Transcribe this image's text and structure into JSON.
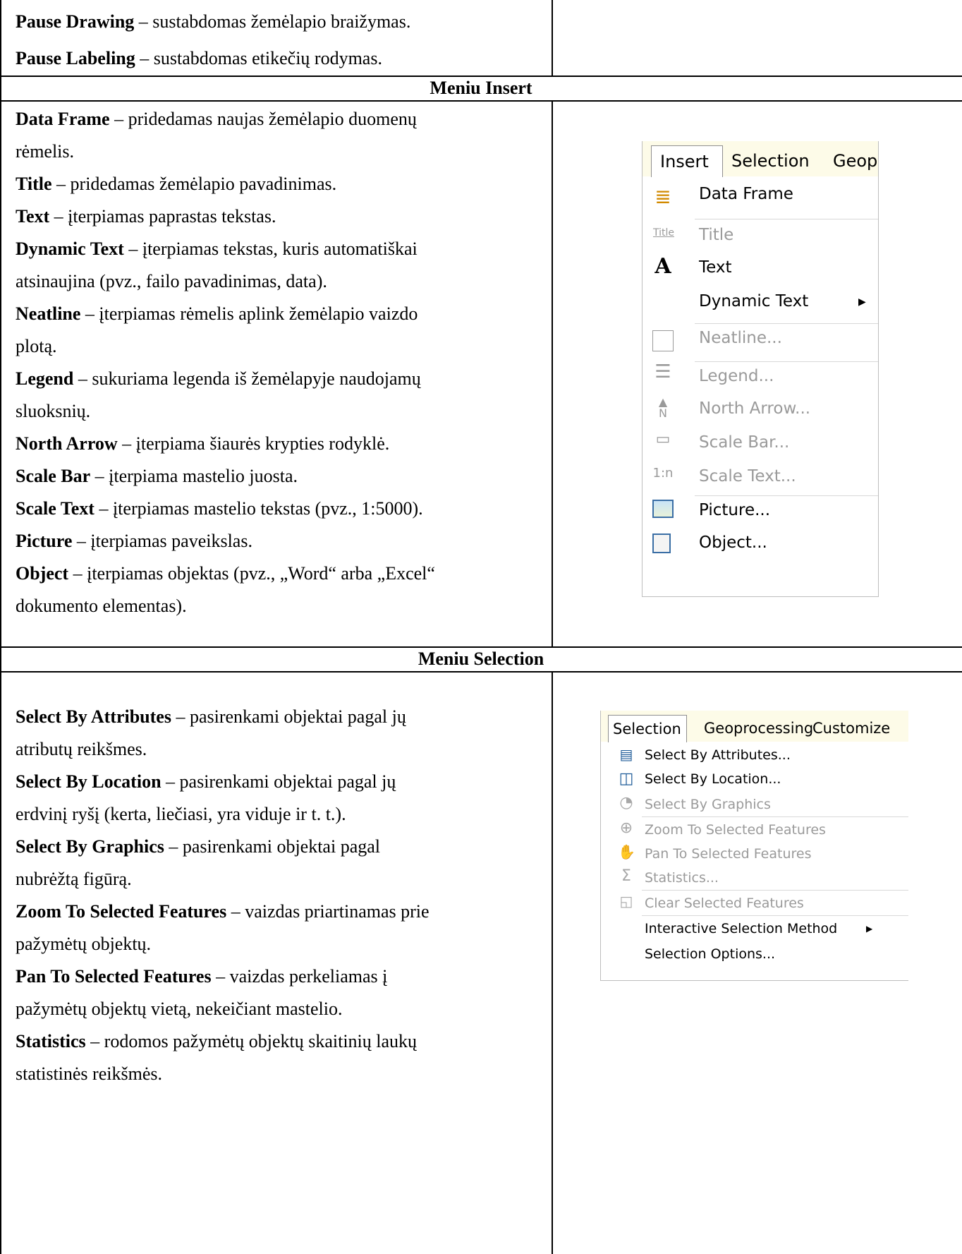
{
  "top_rows": [
    {
      "term": "Pause Drawing",
      "text": " – sustabdomas žemėlapio braižymas."
    },
    {
      "term": "Pause Labeling",
      "text": " – sustabdomas etikečių rodymas."
    }
  ],
  "insert_section": {
    "title": "Meniu Insert",
    "lines": [
      {
        "term": "Data Frame",
        "text": " – pridedamas naujas žemėlapio duomenų"
      },
      {
        "term": "",
        "text": "rėmelis."
      },
      {
        "term": "Title",
        "text": " – pridedamas žemėlapio pavadinimas."
      },
      {
        "term": "Text",
        "text": " – įterpiamas paprastas tekstas."
      },
      {
        "term": "Dynamic Text",
        "text": " – įterpiamas tekstas, kuris automatiškai"
      },
      {
        "term": "",
        "text": "atsinaujina (pvz., failo pavadinimas, data)."
      },
      {
        "term": "Neatline",
        "text": " – įterpiamas rėmelis aplink žemėlapio vaizdo"
      },
      {
        "term": "",
        "text": "plotą."
      },
      {
        "term": "Legend",
        "text": " – sukuriama legenda iš žemėlapyje naudojamų"
      },
      {
        "term": "",
        "text": "sluoksnių."
      },
      {
        "term": "North Arrow",
        "text": " – įterpiama šiaurės krypties rodyklė."
      },
      {
        "term": "Scale Bar",
        "text": " – įterpiama mastelio juosta."
      },
      {
        "term": "Scale Text",
        "text": " – įterpiamas mastelio tekstas (pvz., 1:5000)."
      },
      {
        "term": "Picture",
        "text": " – įterpiamas paveikslas."
      },
      {
        "term": "Object",
        "text": " – įterpiamas objektas (pvz., „Word“ arba „Excel“"
      },
      {
        "term": "",
        "text": "dokumento elementas)."
      }
    ],
    "menu": {
      "tabs": [
        "Insert",
        "Selection",
        "Geop"
      ],
      "items": [
        {
          "label": "Data Frame",
          "icon": "layers-icon",
          "glyph": "≣",
          "disabled": false
        },
        {
          "label": "Title",
          "icon": "title-icon",
          "glyph": "Title",
          "disabled": true
        },
        {
          "label": "Text",
          "icon": "text-a-icon",
          "glyph": "A",
          "disabled": false
        },
        {
          "label": "Dynamic Text",
          "icon": "",
          "glyph": "",
          "disabled": false,
          "submenu": true
        },
        {
          "label": "Neatline...",
          "icon": "neatline-icon",
          "glyph": "□",
          "disabled": true
        },
        {
          "label": "Legend...",
          "icon": "legend-icon",
          "glyph": "☰",
          "disabled": true
        },
        {
          "label": "North Arrow...",
          "icon": "north-arrow-icon",
          "glyph": "N",
          "disabled": true
        },
        {
          "label": "Scale Bar...",
          "icon": "scale-bar-icon",
          "glyph": "▭",
          "disabled": true
        },
        {
          "label": "Scale Text...",
          "icon": "scale-text-icon",
          "glyph": "1:n",
          "disabled": true
        },
        {
          "label": "Picture...",
          "icon": "picture-icon",
          "glyph": "▣",
          "disabled": false
        },
        {
          "label": "Object...",
          "icon": "object-icon",
          "glyph": "▦",
          "disabled": false
        }
      ]
    }
  },
  "selection_section": {
    "title": "Meniu Selection",
    "lines": [
      {
        "term": "Select By Attributes",
        "text": " – pasirenkami objektai pagal jų"
      },
      {
        "term": "",
        "text": "atributų reikšmes."
      },
      {
        "term": "Select By Location",
        "text": " – pasirenkami objektai pagal jų"
      },
      {
        "term": "",
        "text": "erdvinį ryšį (kerta, liečiasi, yra viduje ir t. t.)."
      },
      {
        "term": "Select By Graphics",
        "text": " – pasirenkami objektai pagal"
      },
      {
        "term": "",
        "text": "nubrėžtą figūrą."
      },
      {
        "term": "Zoom To Selected Features",
        "text": " – vaizdas priartinamas prie"
      },
      {
        "term": "",
        "text": "pažymėtų objektų."
      },
      {
        "term": "Pan To Selected Features",
        "text": " – vaizdas perkeliamas į"
      },
      {
        "term": "",
        "text": "pažymėtų objektų vietą, nekeičiant mastelio."
      },
      {
        "term": "Statistics",
        "text": " – rodomos pažymėtų objektų skaitinių laukų"
      },
      {
        "term": "",
        "text": "statistinės reikšmės."
      }
    ],
    "menu": {
      "tabs": [
        "Selection",
        "Geoprocessing",
        "Customize"
      ],
      "items": [
        {
          "label": "Select By Attributes...",
          "icon": "select-by-attributes-icon",
          "glyph": "▤",
          "disabled": false
        },
        {
          "label": "Select By Location...",
          "icon": "select-by-location-icon",
          "glyph": "◫",
          "disabled": false
        },
        {
          "label": "Select By Graphics",
          "icon": "select-by-graphics-icon",
          "glyph": "◔",
          "disabled": true
        },
        {
          "label": "Zoom To Selected Features",
          "icon": "zoom-selected-icon",
          "glyph": "⊕",
          "disabled": true
        },
        {
          "label": "Pan To Selected Features",
          "icon": "pan-selected-icon",
          "glyph": "✋",
          "disabled": true
        },
        {
          "label": "Statistics...",
          "icon": "sigma-icon",
          "glyph": "Σ",
          "disabled": true
        },
        {
          "label": "Clear Selected Features",
          "icon": "clear-selection-icon",
          "glyph": "◱",
          "disabled": true
        },
        {
          "label": "Interactive Selection Method",
          "icon": "",
          "glyph": "",
          "disabled": false,
          "submenu": true
        },
        {
          "label": "Selection Options...",
          "icon": "",
          "glyph": "",
          "disabled": false
        }
      ]
    }
  }
}
